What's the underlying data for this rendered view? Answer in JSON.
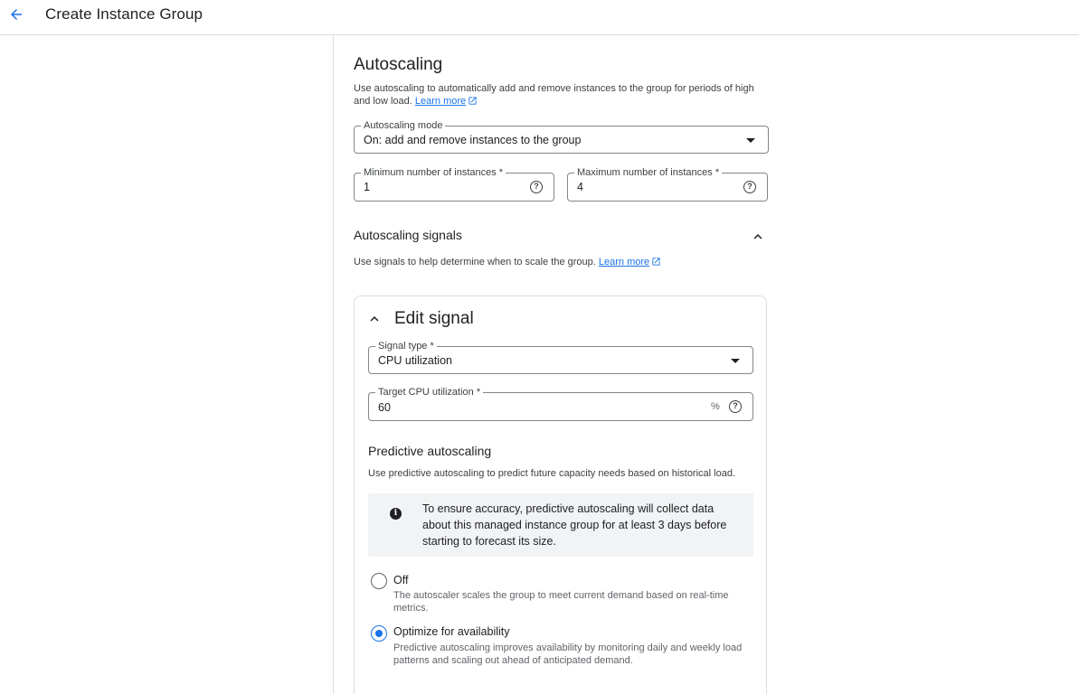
{
  "header": {
    "title": "Create Instance Group"
  },
  "autoscaling": {
    "title": "Autoscaling",
    "description": "Use autoscaling to automatically add and remove instances to the group for periods of high and low load.",
    "learn_more": "Learn more",
    "mode": {
      "label": "Autoscaling mode",
      "value": "On: add and remove instances to the group"
    },
    "min_instances": {
      "label": "Minimum number of instances *",
      "value": "1"
    },
    "max_instances": {
      "label": "Maximum number of instances *",
      "value": "4"
    }
  },
  "signals": {
    "title": "Autoscaling signals",
    "description": "Use signals to help determine when to scale the group.",
    "learn_more": "Learn more"
  },
  "edit_signal": {
    "title": "Edit signal",
    "signal_type": {
      "label": "Signal type *",
      "value": "CPU utilization"
    },
    "target_cpu": {
      "label": "Target CPU utilization *",
      "value": "60",
      "suffix": "%"
    }
  },
  "predictive": {
    "title": "Predictive autoscaling",
    "description": "Use predictive autoscaling to predict future capacity needs based on historical load.",
    "info": "To ensure accuracy, predictive autoscaling will collect data about this managed instance group for at least 3 days before starting to forecast its size.",
    "options": [
      {
        "label": "Off",
        "description": "The autoscaler scales the group to meet current demand based on real-time metrics.",
        "selected": false
      },
      {
        "label": "Optimize for availability",
        "description": "Predictive autoscaling improves availability by monitoring daily and weekly load patterns and scaling out ahead of anticipated demand.",
        "selected": true
      }
    ]
  },
  "colors": {
    "accent": "#1a73e8",
    "border": "#dadce0",
    "info_bg": "#f1f3f4"
  }
}
